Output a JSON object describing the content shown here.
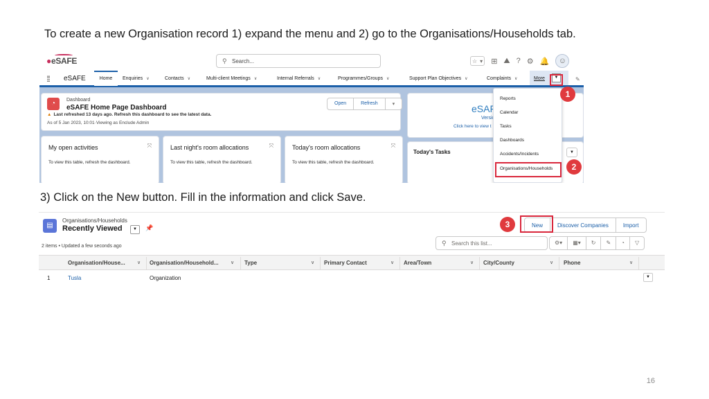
{
  "instructions": {
    "step12": "To create a new Organisation record 1) expand the menu and 2) go to the Organisations/Households tab.",
    "step3": "3) Click on the New button. Fill in the information and click Save."
  },
  "page_number": "16",
  "header": {
    "logo_text": "eSAFE",
    "search_placeholder": "Search...",
    "icons": [
      "star-icon",
      "star-dropdown-icon",
      "add-icon",
      "trailhead-icon",
      "help-icon",
      "setup-gear-icon",
      "notification-bell-icon",
      "avatar-icon"
    ]
  },
  "nav": {
    "app_name": "eSAFE",
    "tabs": [
      {
        "label": "Home"
      },
      {
        "label": "Enquiries"
      },
      {
        "label": "Contacts"
      },
      {
        "label": "Multi-client Meetings"
      },
      {
        "label": "Internal Referrals"
      },
      {
        "label": "Programmes/Groups"
      },
      {
        "label": "Support Plan Objectives"
      },
      {
        "label": "Complaints"
      }
    ],
    "more_label": "More"
  },
  "dashboard": {
    "kicker": "Dashboard",
    "title": "eSAFE Home Page Dashboard",
    "warning": "Last refreshed 13 days ago. Refresh this dashboard to see the latest data.",
    "as_of": "As of 5 Jan 2023, 10:01·Viewing as Enclude Admin",
    "open_label": "Open",
    "refresh_label": "Refresh"
  },
  "right_card": {
    "title": "eSAFE",
    "version": "Versio",
    "link": "Click here to view t"
  },
  "components": [
    {
      "title": "My open activities",
      "body": "To view this table, refresh the dashboard."
    },
    {
      "title": "Last night's room allocations",
      "body": "To view this table, refresh the dashboard."
    },
    {
      "title": "Today's room allocations",
      "body": "To view this table, refresh the dashboard."
    }
  ],
  "tasks": {
    "title": "Today's Tasks"
  },
  "more_menu": {
    "items": [
      "Reports",
      "Calendar",
      "Tasks",
      "Dashboards",
      "Accidents/Incidents",
      "Organisations/Households"
    ]
  },
  "badges": {
    "one": "1",
    "two": "2",
    "three": "3"
  },
  "list_view": {
    "object_label": "Organisations/Households",
    "view_name": "Recently Viewed",
    "meta": "2 items • Updated a few seconds ago",
    "buttons": {
      "new": "New",
      "discover": "Discover Companies",
      "import": "Import"
    },
    "search_placeholder": "Search this list...",
    "columns": [
      "Organisation/House...",
      "Organisation/Household...",
      "Type",
      "Primary Contact",
      "Area/Town",
      "City/County",
      "Phone"
    ],
    "rows": [
      {
        "num": "1",
        "name": "Tusla",
        "record_type": "Organization"
      }
    ]
  },
  "colors": {
    "accent": "#1b5fa8",
    "annotation_red": "#d9263b",
    "brand_pink": "#c72d5c"
  }
}
